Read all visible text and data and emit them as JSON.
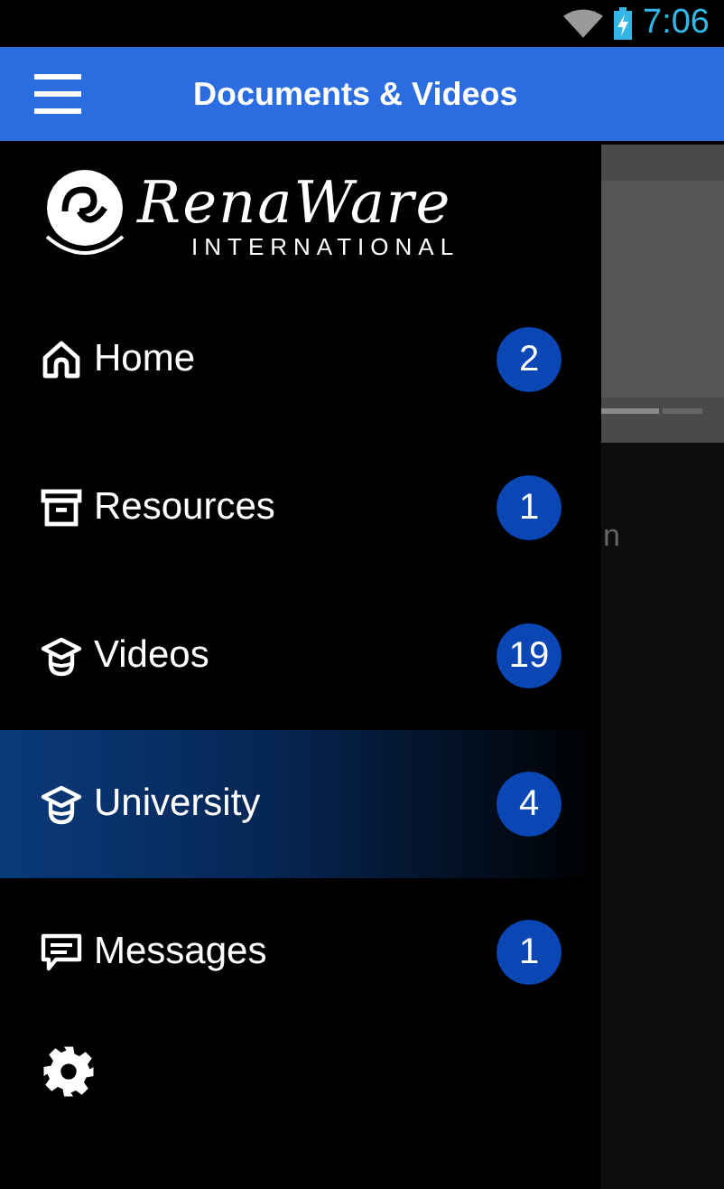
{
  "status_bar": {
    "time": "7:06"
  },
  "app_bar": {
    "title": "Documents & Videos"
  },
  "drawer": {
    "logo": {
      "brand": "RenaWare",
      "subtitle": "INTERNATIONAL"
    },
    "items": [
      {
        "label": "Home",
        "count": "2",
        "kind": "home",
        "selected": false
      },
      {
        "label": "Resources",
        "count": "1",
        "kind": "archive",
        "selected": false
      },
      {
        "label": "Videos",
        "count": "19",
        "kind": "cap",
        "selected": false
      },
      {
        "label": "University",
        "count": "4",
        "kind": "cap",
        "selected": true
      },
      {
        "label": "Messages",
        "count": "1",
        "kind": "chat",
        "selected": false
      }
    ]
  },
  "background": {
    "partial_text": "n"
  }
}
